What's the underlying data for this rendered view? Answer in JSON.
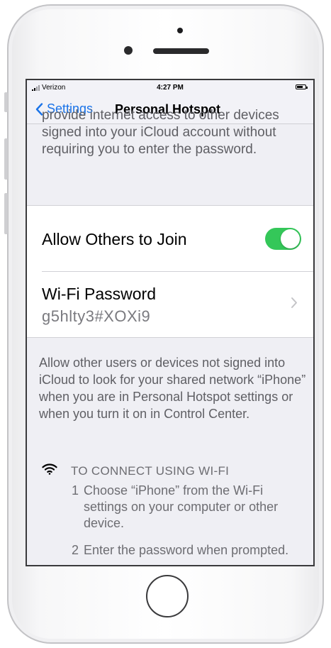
{
  "status_bar": {
    "carrier": "Verizon",
    "time": "4:27 PM",
    "battery_level": 0.7
  },
  "nav": {
    "back_label": "Settings",
    "title": "Personal Hotspot"
  },
  "top_description": "provide internet access to other devices signed into your iCloud account without requiring you to enter the password.",
  "settings": {
    "allow_others_label": "Allow Others to Join",
    "allow_others_on": true,
    "wifi_password_label": "Wi-Fi Password",
    "wifi_password_value": "g5hlty3#XOXi9"
  },
  "footer_description": "Allow other users or devices not signed into iCloud to look for your shared network “iPhone” when you are in Personal Hotspot settings or when you turn it on in Control Center.",
  "connect": {
    "heading": "TO CONNECT USING WI-FI",
    "steps": [
      {
        "num": "1",
        "text": "Choose “iPhone” from the Wi-Fi settings on your computer or other device."
      },
      {
        "num": "2",
        "text": "Enter the password when prompted."
      }
    ]
  },
  "colors": {
    "accent": "#1a73e8",
    "toggle_on": "#34c759",
    "background": "#efeff4"
  },
  "icons": {
    "signal": "signal-icon",
    "battery": "battery-icon",
    "back": "chevron-left-icon",
    "disclosure": "chevron-right-icon",
    "wifi": "wifi-icon"
  }
}
